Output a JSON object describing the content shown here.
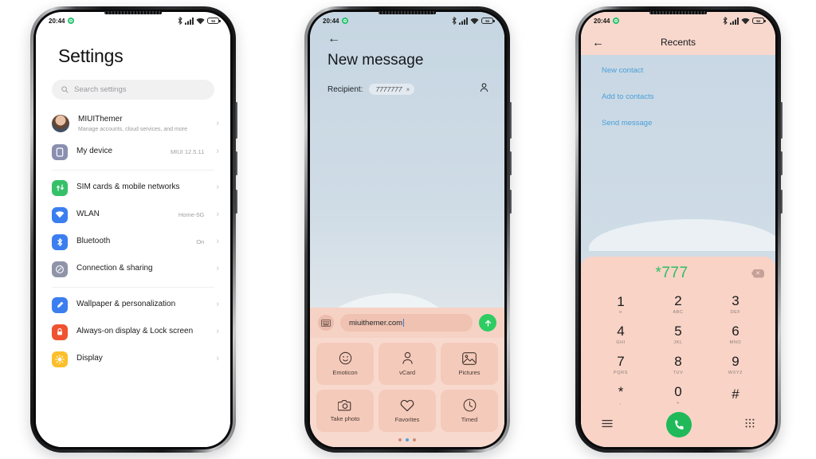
{
  "status_bar": {
    "time": "20:44",
    "battery_label": "94",
    "icons": [
      "bluetooth-icon",
      "signal-icon",
      "wifi-icon",
      "battery-icon"
    ]
  },
  "phone1": {
    "title": "Settings",
    "search": {
      "placeholder": "Search settings",
      "icon": "search-icon"
    },
    "account": {
      "name": "MIUIThemer",
      "subtitle": "Manage accounts, cloud services, and more",
      "avatar": "user-avatar"
    },
    "items": [
      {
        "label": "My device",
        "value": "MIUI 12.5.11",
        "icon": "device-icon",
        "color": "#8a8fb0"
      },
      {
        "label": "SIM cards & mobile networks",
        "value": "",
        "icon": "sim-icon",
        "color": "#37c06a"
      },
      {
        "label": "WLAN",
        "value": "Home-5G",
        "icon": "wifi-icon",
        "color": "#3b7ef0"
      },
      {
        "label": "Bluetooth",
        "value": "On",
        "icon": "bluetooth-icon",
        "color": "#3b7ef0"
      },
      {
        "label": "Connection & sharing",
        "value": "",
        "icon": "connection-icon",
        "color": "#8f94a8"
      },
      {
        "label": "Wallpaper & personalization",
        "value": "",
        "icon": "brush-icon",
        "color": "#3b7ef0"
      },
      {
        "label": "Always-on display & Lock screen",
        "value": "",
        "icon": "lock-icon",
        "color": "#ef5331"
      },
      {
        "label": "Display",
        "value": "",
        "icon": "sun-icon",
        "color": "#fcbf2b"
      }
    ],
    "chevron": "›"
  },
  "phone2": {
    "back_icon": "back-arrow-icon",
    "title": "New message",
    "recipient_label": "Recipient:",
    "recipient_chip": "7777777",
    "chip_remove": "×",
    "contact_icon": "person-icon",
    "keyboard_icon": "keyboard-icon",
    "message_text": "miuithemer.com",
    "send_icon": "send-up-arrow-icon",
    "attachments": [
      {
        "label": "Emoticon",
        "icon": "smiley-icon"
      },
      {
        "label": "vCard",
        "icon": "person-icon"
      },
      {
        "label": "Pictures",
        "icon": "image-icon"
      },
      {
        "label": "Take photo",
        "icon": "camera-icon"
      },
      {
        "label": "Favorites",
        "icon": "heart-icon"
      },
      {
        "label": "Timed",
        "icon": "clock-icon"
      }
    ],
    "pager": {
      "count": 3,
      "active": 1
    }
  },
  "phone3": {
    "back_icon": "back-arrow-icon",
    "title": "Recents",
    "links": [
      "New contact",
      "Add to contacts",
      "Send message"
    ],
    "dialed_number": "*777",
    "delete_icon": "backspace-icon",
    "keys": [
      {
        "digit": "1",
        "sub": "∞"
      },
      {
        "digit": "2",
        "sub": "ABC"
      },
      {
        "digit": "3",
        "sub": "DEF"
      },
      {
        "digit": "4",
        "sub": "GHI"
      },
      {
        "digit": "5",
        "sub": "JKL"
      },
      {
        "digit": "6",
        "sub": "MNO"
      },
      {
        "digit": "7",
        "sub": "PQRS"
      },
      {
        "digit": "8",
        "sub": "TUV"
      },
      {
        "digit": "9",
        "sub": "WXYZ"
      },
      {
        "digit": "*",
        "sub": ","
      },
      {
        "digit": "0",
        "sub": "+"
      },
      {
        "digit": "#",
        "sub": ""
      }
    ],
    "menu_icon": "menu-icon",
    "call_icon": "phone-call-icon",
    "dialpad_icon": "dialpad-icon"
  },
  "colors": {
    "accent_green": "#2ebd63",
    "link_blue": "#4a9fd8",
    "pink_panel": "#f8d3c6",
    "blue_wall": "#c9d8e4"
  }
}
